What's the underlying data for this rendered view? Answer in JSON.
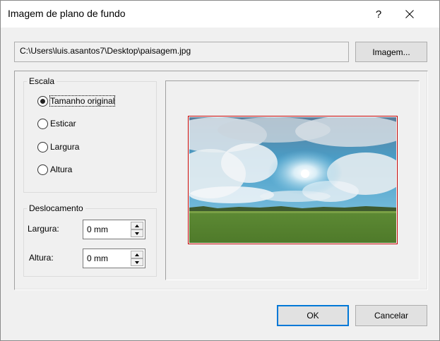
{
  "dialog": {
    "title": "Imagem de plano de fundo",
    "help_glyph": "?"
  },
  "file": {
    "path": "C:\\Users\\luis.asantos7\\Desktop\\paisagem.jpg",
    "browse_label": "Imagem..."
  },
  "scale": {
    "group_label": "Escala",
    "options": [
      {
        "label": "Tamanho original",
        "checked": true
      },
      {
        "label": "Esticar",
        "checked": false
      },
      {
        "label": "Largura",
        "checked": false
      },
      {
        "label": "Altura",
        "checked": false
      }
    ]
  },
  "offset": {
    "group_label": "Deslocamento",
    "width_label": "Largura:",
    "width_value": "0 mm",
    "height_label": "Altura:",
    "height_value": "0 mm"
  },
  "buttons": {
    "ok": "OK",
    "cancel": "Cancelar"
  },
  "preview": {
    "description_icon": "landscape-preview-image",
    "frame_color": "#c00000"
  },
  "colors": {
    "accent": "#0078d7",
    "dialog_bg": "#f0f0f0"
  }
}
